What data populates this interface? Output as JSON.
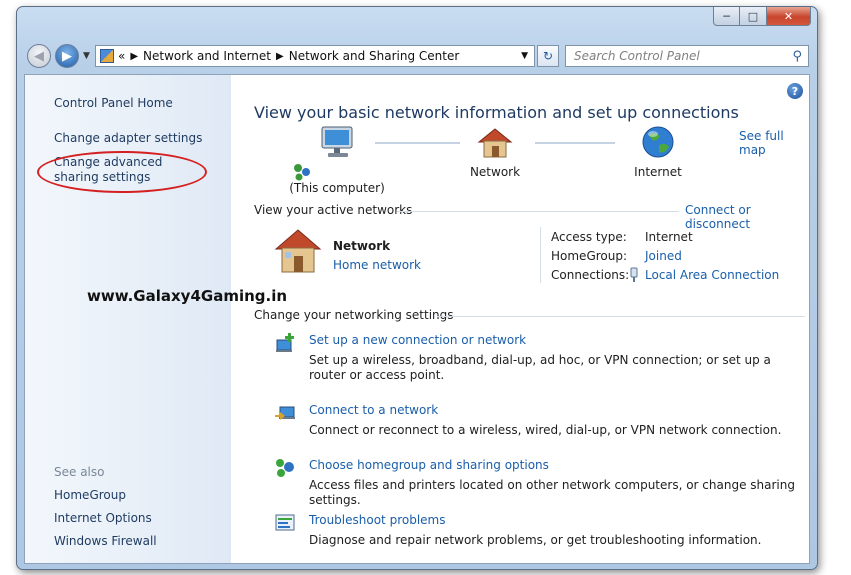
{
  "window": {
    "caption": {
      "minimize": "─",
      "maximize": "□",
      "close": "✕"
    }
  },
  "navbar": {
    "back_glyph": "◀",
    "forward_glyph": "▶",
    "breadcrumb_lead": "«",
    "breadcrumb": [
      "Network and Internet",
      "Network and Sharing Center"
    ],
    "refresh_glyph": "↻",
    "search_placeholder": "Search Control Panel"
  },
  "sidebar": {
    "home": "Control Panel Home",
    "links": [
      "Change adapter settings",
      "Change advanced sharing settings"
    ],
    "see_also_heading": "See also",
    "see_also": [
      "HomeGroup",
      "Internet Options",
      "Windows Firewall"
    ]
  },
  "watermark": "www.Galaxy4Gaming.in",
  "main": {
    "title": "View your basic network information and set up connections",
    "see_full_map": "See full map",
    "map": {
      "computer_label": "(This computer)",
      "network_label": "Network",
      "internet_label": "Internet"
    },
    "active_networks": {
      "heading": "View your active networks",
      "connect_link": "Connect or disconnect",
      "network_name": "Network",
      "network_type": "Home network",
      "access_type_label": "Access type:",
      "access_type_value": "Internet",
      "homegroup_label": "HomeGroup:",
      "homegroup_value": "Joined",
      "connections_label": "Connections:",
      "connections_value": "Local Area Connection"
    },
    "change_settings": {
      "heading": "Change your networking settings",
      "tasks": [
        {
          "title": "Set up a new connection or network",
          "desc": "Set up a wireless, broadband, dial-up, ad hoc, or VPN connection; or set up a router or access point."
        },
        {
          "title": "Connect to a network",
          "desc": "Connect or reconnect to a wireless, wired, dial-up, or VPN network connection."
        },
        {
          "title": "Choose homegroup and sharing options",
          "desc": "Access files and printers located on other network computers, or change sharing settings."
        },
        {
          "title": "Troubleshoot problems",
          "desc": "Diagnose and repair network problems, or get troubleshooting information."
        }
      ]
    }
  },
  "colors": {
    "link": "#1a5eaa",
    "title": "#1e3a64",
    "annotation_circle": "#d42020",
    "sidebar_bg": "#e6eef8",
    "frame": "#b8cfe8"
  },
  "icons": [
    "computer-icon",
    "house-icon",
    "globe-icon",
    "network-house-icon",
    "new-connection-icon",
    "connect-network-icon",
    "homegroup-icon",
    "troubleshoot-icon",
    "ethernet-plug-icon",
    "help-icon",
    "search-icon"
  ]
}
